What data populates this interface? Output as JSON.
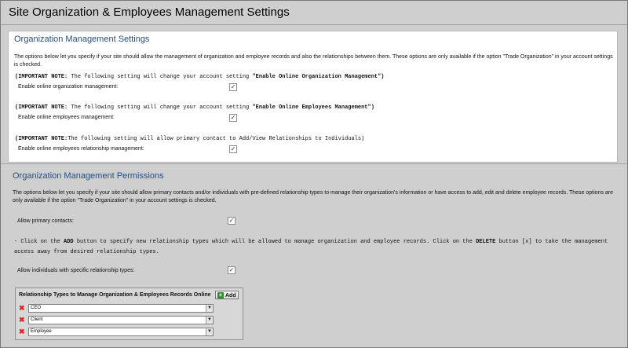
{
  "page_title": "Site Organization & Employees Management Settings",
  "settings": {
    "title": "Organization Management Settings",
    "description": "The options below let you specify if your site should allow the management of organization and employee records and also the relationships between them. These options are only available if the option \"Trade Organization\" in your account settings is checked.",
    "notes": [
      {
        "prefix": "(IMPORTANT NOTE:",
        "text": " The following setting will change your account setting ",
        "setting": "\"Enable Online Organization Management\")"
      },
      {
        "prefix": "(IMPORTANT NOTE:",
        "text": " The following setting will change your account setting ",
        "setting": "\"Enable Online Employees Management\")"
      },
      {
        "prefix": "(IMPORTANT NOTE:",
        "text": "The following setting will allow primary contact to Add/View Relationships to Individuals)",
        "setting": ""
      }
    ],
    "options": [
      {
        "label": "Enable online organization management:",
        "checked": true
      },
      {
        "label": "Enable online employees management:",
        "checked": true
      },
      {
        "label": "Enable online employees relationship management:",
        "checked": true
      }
    ]
  },
  "permissions": {
    "title": "Organization Management Permissions",
    "description": "The options below let you specify if your site should allow primary contacts and/or individuals with pre-defined relationship types to manage their organization's information or have access to add, edit and delete employee records. These options are only available if the option \"Trade Organization\" in your account settings is checked.",
    "allow_primary_label": "Allow primary contacts:",
    "allow_primary_checked": true,
    "instruction": {
      "line1_a": "- Click on the ",
      "add_word": "ADD",
      "line1_b": " button to specify new relationship types which will be allowed to manage organization and employee records. Click on the ",
      "delete_word": "DELETE",
      "line1_c": " button [x] to take the management",
      "line2": "access away from desired relationship types."
    },
    "allow_individuals_label": "Allow individuals with specific relationship types:",
    "allow_individuals_checked": true,
    "relationship_box": {
      "header": "Relationship Types to Manage Organization & Employees Records Online",
      "add_label": "Add",
      "rows": [
        "CEO",
        "Client",
        "Employee"
      ]
    }
  },
  "icons": {
    "check": "checkmark-icon",
    "remove": "delete-x-icon",
    "add": "plus-icon",
    "dropdown": "chevron-down-icon"
  },
  "colors": {
    "section_title": "#1e4e8c",
    "delete_icon": "#dd2222",
    "add_icon": "#2e8b2e",
    "panel_bg": "#ffffff",
    "page_bg": "#cfcfcf"
  }
}
